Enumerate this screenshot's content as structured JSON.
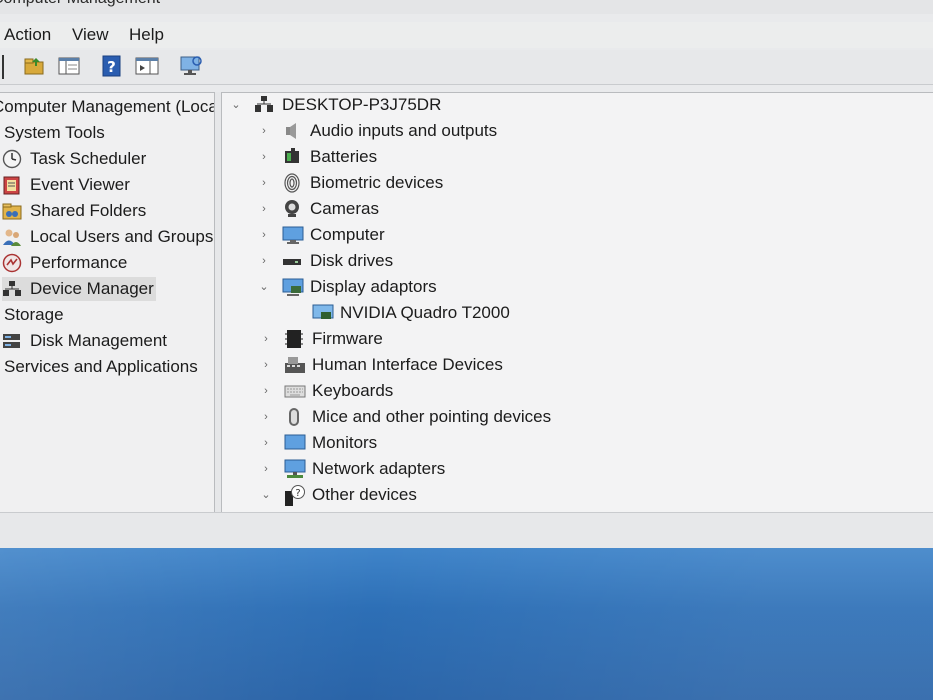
{
  "window": {
    "title": "Computer Management"
  },
  "menubar": {
    "items": [
      "Action",
      "View",
      "Help"
    ]
  },
  "toolbar": {
    "buttons": [
      "folder-up-icon",
      "console-tree-icon",
      "help-icon",
      "action-pane-icon",
      "monitor-icon"
    ]
  },
  "left_tree": {
    "root": "Computer Management (Local)",
    "items": [
      {
        "label": "System Tools",
        "icon": "computer-icon"
      },
      {
        "label": "Task Scheduler",
        "icon": "clock-icon"
      },
      {
        "label": "Event Viewer",
        "icon": "event-viewer-icon"
      },
      {
        "label": "Shared Folders",
        "icon": "shared-folder-icon"
      },
      {
        "label": "Local Users and Groups",
        "icon": "users-icon"
      },
      {
        "label": "Performance",
        "icon": "performance-icon"
      },
      {
        "label": "Device Manager",
        "icon": "device-manager-icon"
      },
      {
        "label": "Storage",
        "icon": "storage-icon"
      },
      {
        "label": "Disk Management",
        "icon": "disk-management-icon"
      },
      {
        "label": "Services and Applications",
        "icon": "services-icon"
      }
    ],
    "selected": "Device Manager"
  },
  "device_tree": {
    "computer": "DESKTOP-P3J75DR",
    "categories": [
      {
        "label": "Audio inputs and outputs",
        "expanded": false
      },
      {
        "label": "Batteries",
        "expanded": false
      },
      {
        "label": "Biometric devices",
        "expanded": false
      },
      {
        "label": "Cameras",
        "expanded": false
      },
      {
        "label": "Computer",
        "expanded": false
      },
      {
        "label": "Disk drives",
        "expanded": false
      },
      {
        "label": "Display adaptors",
        "expanded": true
      },
      {
        "label": "NVIDIA Quadro T2000",
        "child": true
      },
      {
        "label": "Firmware",
        "expanded": false
      },
      {
        "label": "Human Interface Devices",
        "expanded": false
      },
      {
        "label": "Keyboards",
        "expanded": false
      },
      {
        "label": "Mice and other pointing devices",
        "expanded": false
      },
      {
        "label": "Monitors",
        "expanded": false
      },
      {
        "label": "Network adapters",
        "expanded": false
      },
      {
        "label": "Other devices",
        "expanded": true
      }
    ]
  },
  "glyphs": {
    "expand": "›",
    "collapse": "⌄"
  },
  "colors": {
    "accent": "#3c78c8",
    "selection": "#dcdcdc",
    "desktop": "#2d6fb6"
  }
}
